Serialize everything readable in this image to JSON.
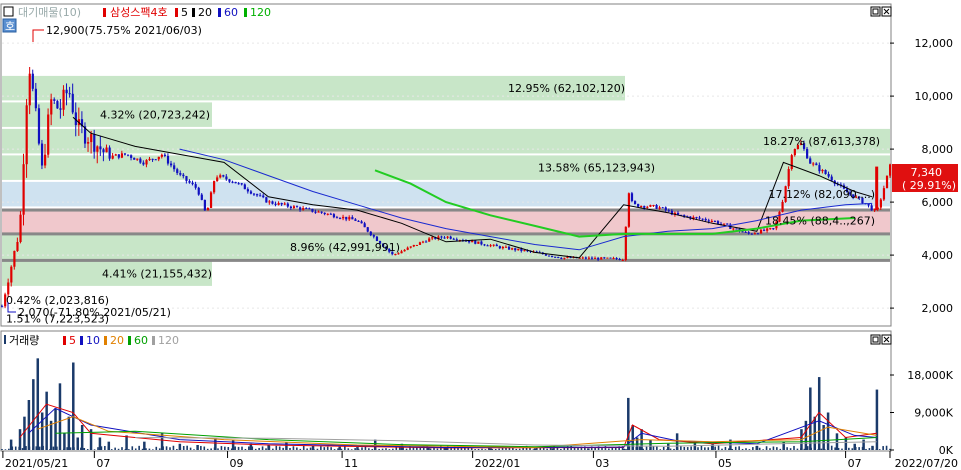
{
  "chart_data": [
    {
      "type": "candlestick",
      "legend": {
        "stock_name": "대기매물(10)",
        "series_label": "삼성스팩4호",
        "ma": [
          "5",
          "20",
          "60",
          "120"
        ],
        "colors": {
          "stock": "#e00000",
          "ma5": "#e00000",
          "ma20": "#000000",
          "ma60": "#1010c0",
          "ma120": "#00b000"
        }
      },
      "y_ticks": [
        2000,
        4000,
        6000,
        8000,
        10000,
        12000
      ],
      "y_tick_labels": [
        "2,000",
        "4,000",
        "6,000",
        "8,000",
        "10,000",
        "12,000"
      ],
      "ylim": [
        1400,
        13400
      ],
      "x_ticks": [
        "2021/05/21",
        "07",
        "09",
        "11",
        "2022/01",
        "03",
        "05",
        "07",
        "2022/07/20"
      ],
      "current_price": {
        "value": 7340,
        "label": "7,340",
        "change": "( 29.91%)"
      },
      "annotations": [
        {
          "text": "12,900(75.75% 2021/06/03)",
          "price": 12900
        },
        {
          "text": "2,070(-71.80% 2021/05/21)",
          "price": 2070
        }
      ],
      "volume_bands": [
        {
          "low": 9800,
          "high": 10800,
          "label": "12.95% (62,102,120)",
          "color": "#c8e6c8"
        },
        {
          "low": 8800,
          "high": 9800,
          "label": "4.32% (20,723,242)",
          "color": "#c8e6c8"
        },
        {
          "low": 7800,
          "high": 8800,
          "label": "18.27% (87,613,378)",
          "color": "#c8e6c8"
        },
        {
          "low": 6800,
          "high": 7800,
          "label": "13.58% (65,123,943)",
          "color": "#c8e6c8"
        },
        {
          "low": 5800,
          "high": 6800,
          "label": "17.12% (82,090,...)",
          "color": "#cfe2f0"
        },
        {
          "low": 4800,
          "high": 5800,
          "label": "18.45% (88,4..,267)",
          "color": "#f0c8cc"
        },
        {
          "low": 3800,
          "high": 4800,
          "label": "8.96% (42,991,991)",
          "color": "#c8e6c8"
        },
        {
          "low": 2800,
          "high": 3800,
          "label": "4.41% (21,155,432)",
          "color": "#c8e6c8"
        },
        {
          "low": 1800,
          "high": 2800,
          "label": "0.42% (2,023,816)",
          "color": "#ffffff"
        },
        {
          "low": 800,
          "high": 1800,
          "label": "1.51% (7,223,523)",
          "color": "#ffffff"
        }
      ],
      "ma_lines": {
        "ma20": [
          [
            0.08,
            9200
          ],
          [
            0.1,
            8600
          ],
          [
            0.15,
            8100
          ],
          [
            0.2,
            7800
          ],
          [
            0.25,
            7500
          ],
          [
            0.3,
            6200
          ],
          [
            0.35,
            5900
          ],
          [
            0.4,
            5700
          ],
          [
            0.45,
            5200
          ],
          [
            0.5,
            4500
          ],
          [
            0.55,
            4600
          ],
          [
            0.6,
            4100
          ],
          [
            0.65,
            3900
          ],
          [
            0.7,
            5900
          ],
          [
            0.75,
            5600
          ],
          [
            0.8,
            5200
          ],
          [
            0.85,
            4900
          ],
          [
            0.88,
            7500
          ],
          [
            0.92,
            7000
          ],
          [
            0.96,
            6400
          ],
          [
            0.98,
            6200
          ]
        ],
        "ma60": [
          [
            0.2,
            8000
          ],
          [
            0.25,
            7600
          ],
          [
            0.3,
            7000
          ],
          [
            0.35,
            6400
          ],
          [
            0.4,
            5900
          ],
          [
            0.45,
            5400
          ],
          [
            0.5,
            5000
          ],
          [
            0.55,
            4700
          ],
          [
            0.6,
            4400
          ],
          [
            0.65,
            4200
          ],
          [
            0.7,
            4700
          ],
          [
            0.75,
            4900
          ],
          [
            0.8,
            5000
          ],
          [
            0.85,
            5300
          ],
          [
            0.9,
            5700
          ],
          [
            0.95,
            5900
          ],
          [
            0.98,
            5950
          ]
        ],
        "ma120": [
          [
            0.42,
            7200
          ],
          [
            0.46,
            6700
          ],
          [
            0.5,
            6000
          ],
          [
            0.55,
            5500
          ],
          [
            0.6,
            5100
          ],
          [
            0.65,
            4700
          ],
          [
            0.7,
            4800
          ],
          [
            0.75,
            4800
          ],
          [
            0.8,
            4800
          ],
          [
            0.85,
            5000
          ],
          [
            0.9,
            5300
          ],
          [
            0.96,
            5400
          ]
        ]
      }
    },
    {
      "type": "bar",
      "legend": {
        "title": "거래량",
        "ma": [
          "5",
          "10",
          "20",
          "60",
          "120"
        ],
        "colors": {
          "ma5": "#e00000",
          "ma10": "#1010c0",
          "ma20": "#e08000",
          "ma60": "#00a000",
          "ma120": "#808080"
        }
      },
      "y_ticks": [
        0,
        9000,
        18000
      ],
      "y_tick_labels": [
        "0K",
        "9,000K",
        "18,000K"
      ],
      "ylim": [
        0,
        24000
      ],
      "volume_spikes": [
        [
          0.01,
          2500
        ],
        [
          0.02,
          5000
        ],
        [
          0.025,
          8000
        ],
        [
          0.03,
          12000
        ],
        [
          0.035,
          17000
        ],
        [
          0.04,
          22000
        ],
        [
          0.045,
          9000
        ],
        [
          0.05,
          14000
        ],
        [
          0.055,
          7000
        ],
        [
          0.06,
          10000
        ],
        [
          0.065,
          16000
        ],
        [
          0.07,
          4000
        ],
        [
          0.075,
          8000
        ],
        [
          0.08,
          21000
        ],
        [
          0.085,
          3000
        ],
        [
          0.09,
          6000
        ],
        [
          0.1,
          5000
        ],
        [
          0.11,
          3000
        ],
        [
          0.12,
          2000
        ],
        [
          0.14,
          3500
        ],
        [
          0.16,
          2000
        ],
        [
          0.18,
          4000
        ],
        [
          0.2,
          1500
        ],
        [
          0.22,
          1200
        ],
        [
          0.24,
          3000
        ],
        [
          0.26,
          2500
        ],
        [
          0.28,
          1500
        ],
        [
          0.3,
          1200
        ],
        [
          0.32,
          1800
        ],
        [
          0.35,
          1000
        ],
        [
          0.38,
          800
        ],
        [
          0.4,
          700
        ],
        [
          0.42,
          2500
        ],
        [
          0.45,
          1500
        ],
        [
          0.48,
          600
        ],
        [
          0.5,
          500
        ],
        [
          0.55,
          400
        ],
        [
          0.6,
          400
        ],
        [
          0.62,
          400
        ],
        [
          0.66,
          400
        ],
        [
          0.7,
          300
        ],
        [
          0.705,
          12500
        ],
        [
          0.71,
          6000
        ],
        [
          0.715,
          3000
        ],
        [
          0.72,
          5000
        ],
        [
          0.73,
          2500
        ],
        [
          0.75,
          1500
        ],
        [
          0.76,
          4000
        ],
        [
          0.78,
          2000
        ],
        [
          0.8,
          1500
        ],
        [
          0.82,
          2500
        ],
        [
          0.85,
          1000
        ],
        [
          0.88,
          2000
        ],
        [
          0.9,
          5000
        ],
        [
          0.905,
          7000
        ],
        [
          0.91,
          15000
        ],
        [
          0.915,
          8000
        ],
        [
          0.92,
          17500
        ],
        [
          0.925,
          6000
        ],
        [
          0.93,
          9000
        ],
        [
          0.94,
          4000
        ],
        [
          0.95,
          3000
        ],
        [
          0.96,
          1500
        ],
        [
          0.97,
          2500
        ],
        [
          0.98,
          1000
        ],
        [
          0.985,
          14500
        ]
      ]
    }
  ]
}
